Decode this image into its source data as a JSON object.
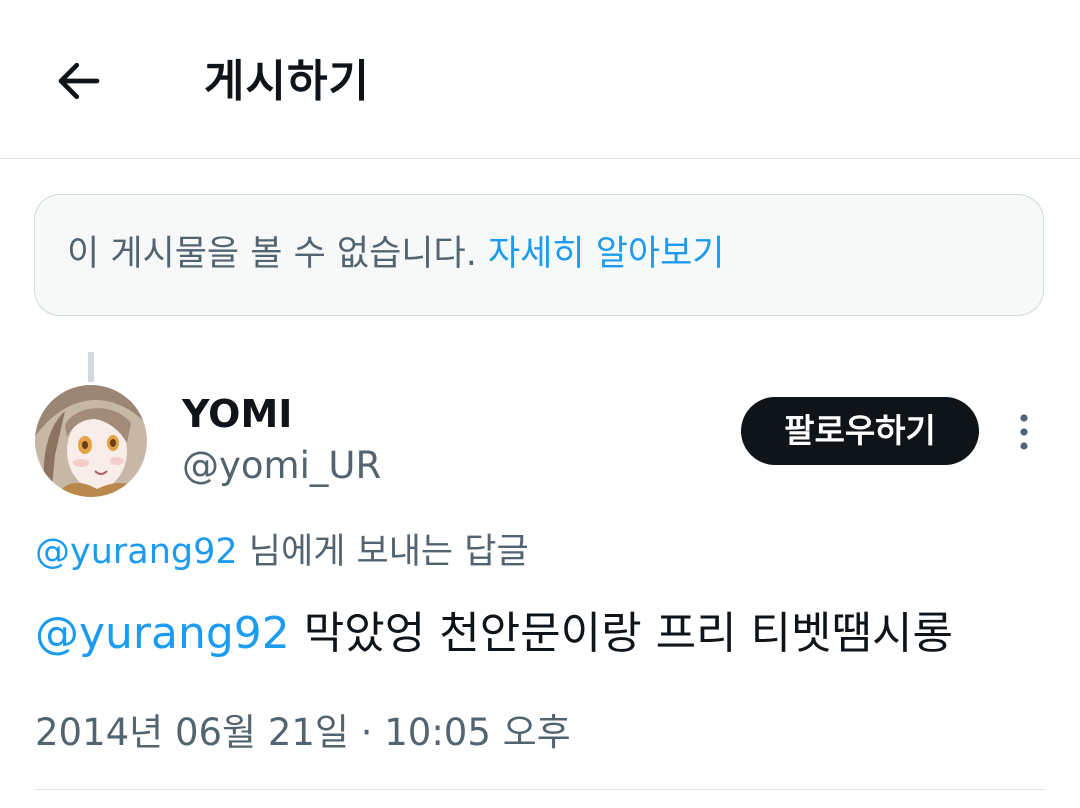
{
  "header": {
    "title": "게시하기",
    "back_icon": "arrow-left-icon"
  },
  "notice": {
    "text": "이 게시물을 볼 수 없습니다. ",
    "link": "자세히 알아보기"
  },
  "tweet": {
    "author": {
      "display_name": "YOMI",
      "handle": "@yomi_UR",
      "avatar": "anime-girl-avatar"
    },
    "follow_label": "팔로우하기",
    "more_icon": "more-vertical-icon",
    "reply_to": {
      "mention": "@yurang92",
      "suffix": " 님에게 보내는 답글"
    },
    "body": {
      "mention": "@yurang92",
      "text": " 막았엉 천안문이랑 프리 티벳땜시롱"
    },
    "timestamp": "2014년 06월 21일 · 10:05 오후"
  },
  "colors": {
    "accent": "#1d9bf0",
    "secondary_text": "#536471",
    "primary_text": "#0f1419",
    "border": "#cfd9de"
  }
}
